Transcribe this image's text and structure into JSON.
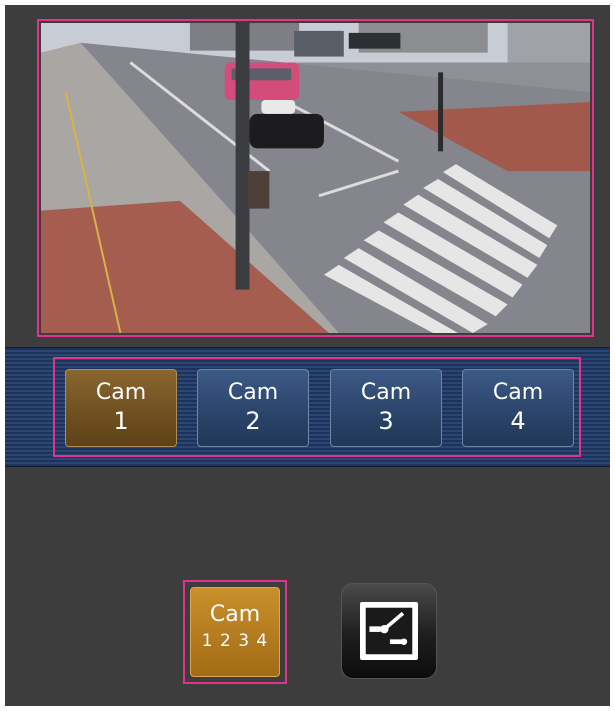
{
  "camera_view": {
    "active_camera": "Cam 1"
  },
  "camera_selector": {
    "buttons": [
      {
        "line1": "Cam",
        "line2": "1",
        "active": true
      },
      {
        "line1": "Cam",
        "line2": "2",
        "active": false
      },
      {
        "line1": "Cam",
        "line2": "3",
        "active": false
      },
      {
        "line1": "Cam",
        "line2": "4",
        "active": false
      }
    ]
  },
  "bottom_controls": {
    "multi_screen_line1": "Cam",
    "multi_screen_line2": "1 2 3 4",
    "control_icon": "camera-control-icon"
  },
  "colors": {
    "highlight": "#e0338a",
    "active_cam": "#7a5a28",
    "inactive_cam": "#2f4a75",
    "multi_button": "#b9821f",
    "background": "#3d3d3d"
  }
}
